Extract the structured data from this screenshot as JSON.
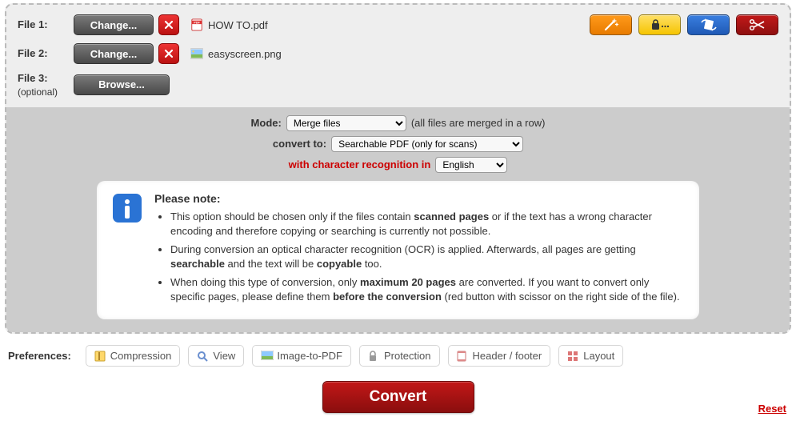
{
  "files": {
    "row1": {
      "label": "File 1:",
      "button": "Change...",
      "filename": "HOW TO.pdf",
      "filetype": "pdf"
    },
    "row2": {
      "label": "File 2:",
      "button": "Change...",
      "filename": "easyscreen.png",
      "filetype": "png"
    },
    "row3": {
      "label": "File 3:",
      "optional": "(optional)",
      "button": "Browse..."
    }
  },
  "mode": {
    "label": "Mode:",
    "selected": "Merge files",
    "hint": "(all files are merged in a row)"
  },
  "convert": {
    "label": "convert to:",
    "selected": "Searchable PDF (only for scans)"
  },
  "ocr": {
    "label": "with character recognition in",
    "selected": "English"
  },
  "note": {
    "title": "Please note:",
    "items": [
      {
        "pre": "This option should be chosen only if the files contain ",
        "b1": "scanned pages",
        "mid": " or if the text has a wrong character encoding and therefore copying or searching is currently not possible."
      },
      {
        "pre": "During conversion an optical character recognition (OCR) is applied. Afterwards, all pages are getting ",
        "b1": "searchable",
        "mid": " and the text will be ",
        "b2": "copyable",
        "end": " too."
      },
      {
        "pre": "When doing this type of conversion, only ",
        "b1": "maximum 20 pages",
        "mid": " are converted. If you want to convert only specific pages, please define them ",
        "b2": "before the conversion",
        "end": " (red button with scissor on the right side of the file)."
      }
    ]
  },
  "prefs": {
    "label": "Preferences:",
    "items": {
      "compression": "Compression",
      "view": "View",
      "image": "Image-to-PDF",
      "protection": "Protection",
      "header": "Header / footer",
      "layout": "Layout"
    }
  },
  "actions": {
    "convert": "Convert",
    "reset": "Reset"
  }
}
